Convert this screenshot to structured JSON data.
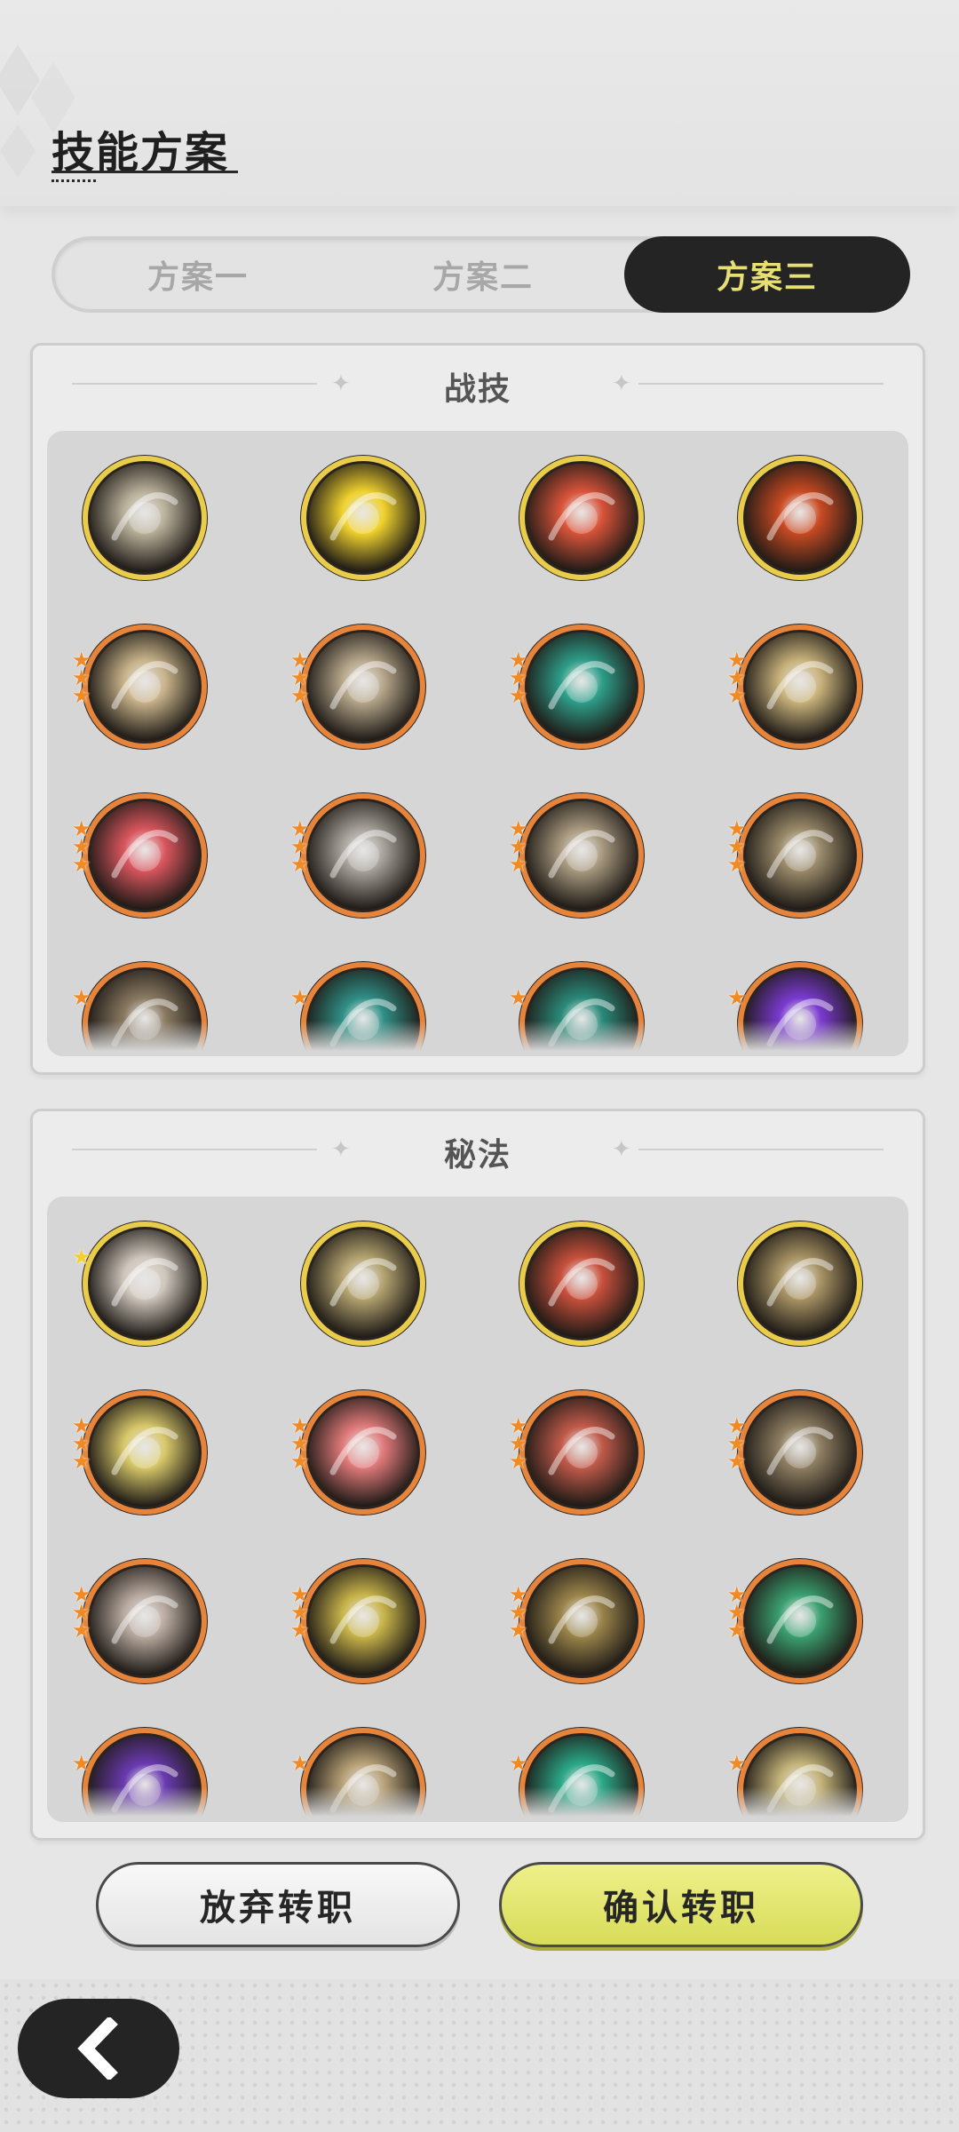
{
  "header": {
    "title": "技能方案"
  },
  "tabs": [
    {
      "label": "方案一",
      "active": false
    },
    {
      "label": "方案二",
      "active": false
    },
    {
      "label": "方案三",
      "active": true
    }
  ],
  "sections": [
    {
      "title": "战技",
      "skills": [
        {
          "icon": "whirlwind-icon",
          "frame": "gold",
          "color": "#b9b09a",
          "stars": 0
        },
        {
          "icon": "shield-up-icon",
          "frame": "gold",
          "color": "#f0d22e",
          "stars": 0
        },
        {
          "icon": "flame-slash-icon",
          "frame": "gold",
          "color": "#d9543a",
          "stars": 0
        },
        {
          "icon": "fire-icon",
          "frame": "gold",
          "color": "#c84a22",
          "stars": 0
        },
        {
          "icon": "burst-icon",
          "frame": "orange",
          "color": "#c8b38a",
          "stars": 3
        },
        {
          "icon": "swirl-icon",
          "frame": "orange",
          "color": "#b6a78b",
          "stars": 3
        },
        {
          "icon": "wind-wave-icon",
          "frame": "orange",
          "color": "#2e9e8a",
          "stars": 3
        },
        {
          "icon": "slash-icon",
          "frame": "orange",
          "color": "#c9b37c",
          "stars": 3
        },
        {
          "icon": "warrior-cry-icon",
          "frame": "orange",
          "color": "#d9565e",
          "stars": 3
        },
        {
          "icon": "charge-icon",
          "frame": "orange",
          "color": "#a7a29a",
          "stars": 3
        },
        {
          "icon": "grab-icon",
          "frame": "orange",
          "color": "#a99a80",
          "stars": 3
        },
        {
          "icon": "crescent-strike-icon",
          "frame": "orange",
          "color": "#9a8a6a",
          "stars": 3
        },
        {
          "icon": "leap-icon",
          "frame": "orange",
          "color": "#8a7a62",
          "stars": 1
        },
        {
          "icon": "web-icon",
          "frame": "orange",
          "color": "#2f8f86",
          "stars": 1
        },
        {
          "icon": "sword-icon",
          "frame": "orange",
          "color": "#2a8a7a",
          "stars": 1
        },
        {
          "icon": "void-icon",
          "frame": "orange",
          "color": "#7a3ad0",
          "stars": 1
        }
      ]
    },
    {
      "title": "秘法",
      "skills": [
        {
          "icon": "blade-icon",
          "frame": "gold",
          "color": "#cfc6bc",
          "stars": 1,
          "star_color": "gold"
        },
        {
          "icon": "golem-icon",
          "frame": "gold",
          "color": "#b3a370",
          "stars": 0
        },
        {
          "icon": "armor-icon",
          "frame": "gold",
          "color": "#c8503c",
          "stars": 0
        },
        {
          "icon": "vortex-icon",
          "frame": "gold",
          "color": "#a89364",
          "stars": 0
        },
        {
          "icon": "eye-icon",
          "frame": "orange",
          "color": "#d8c86a",
          "stars": 3
        },
        {
          "icon": "sword-heal-icon",
          "frame": "orange",
          "color": "#e07a7a",
          "stars": 3
        },
        {
          "icon": "blood-slash-icon",
          "frame": "orange",
          "color": "#c05a4a",
          "stars": 3
        },
        {
          "icon": "beast-icon",
          "frame": "orange",
          "color": "#8e7e62",
          "stars": 3
        },
        {
          "icon": "dagger-icon",
          "frame": "orange",
          "color": "#b8aaa0",
          "stars": 3
        },
        {
          "icon": "spirit-icon",
          "frame": "orange",
          "color": "#c8b44a",
          "stars": 3
        },
        {
          "icon": "chestplate-icon",
          "frame": "orange",
          "color": "#9a844a",
          "stars": 3
        },
        {
          "icon": "heart-heal-icon",
          "frame": "orange",
          "color": "#3aa070",
          "stars": 3
        },
        {
          "icon": "dark-wave-icon",
          "frame": "orange",
          "color": "#6a3ab0",
          "stars": 1
        },
        {
          "icon": "sword-up-icon",
          "frame": "orange",
          "color": "#b8a278",
          "stars": 1
        },
        {
          "icon": "leaf-blade-icon",
          "frame": "orange",
          "color": "#2aa888",
          "stars": 1
        },
        {
          "icon": "moon-heal-icon",
          "frame": "orange",
          "color": "#c4b47a",
          "stars": 1
        }
      ]
    }
  ],
  "buttons": {
    "cancel": "放弃转职",
    "confirm": "确认转职"
  },
  "colors": {
    "accent_yellow": "#e7de74",
    "confirm_bg": "#dcdf5e",
    "frame_gold": "#e9cc4a",
    "frame_orange": "#e5843a",
    "dark": "#242424"
  }
}
